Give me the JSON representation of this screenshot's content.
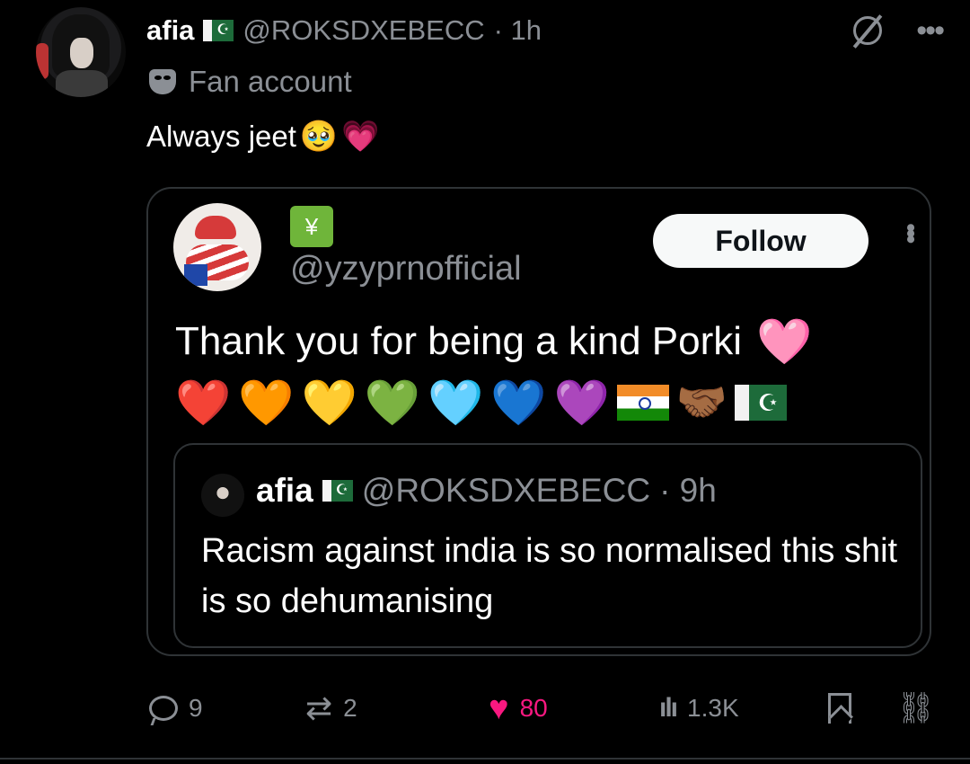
{
  "post": {
    "author_name": "afia",
    "author_flag": "☪",
    "author_handle": "@ROKSDXEBECC",
    "time": "· 1h",
    "label": "Fan account",
    "text": "Always jeet",
    "emojis": [
      "🥹",
      "💗"
    ]
  },
  "quoted_post": {
    "chart_emoji": "¥",
    "handle": "@yzyprnofficial",
    "follow_label": "Follow",
    "text": "Thank you for being a kind Porki",
    "text_emoji": "🩷",
    "hearts": [
      "❤️",
      "🧡",
      "💛",
      "💚",
      "🩵",
      "💙",
      "💜"
    ],
    "handshake": "🤝🏾",
    "pk_symbol": "☪"
  },
  "nested_quote": {
    "author_name": "afia",
    "author_flag": "☪",
    "author_handle": "@ROKSDXEBECC",
    "time": "· 9h",
    "text": "Racism against india is so normalised this shit is so dehumanising"
  },
  "actions": {
    "replies": "9",
    "reposts": "2",
    "likes": "80",
    "views": "1.3K"
  },
  "colors": {
    "background": "#000000",
    "like": "#f91880",
    "muted": "#8b8f95"
  }
}
